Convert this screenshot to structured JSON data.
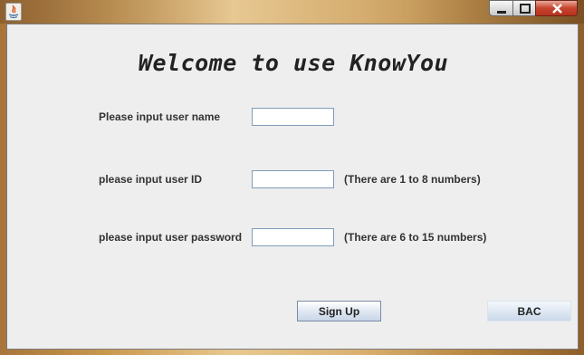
{
  "window": {
    "icon": "java-icon",
    "controls": [
      "minimize-icon",
      "maximize-icon",
      "close-icon"
    ]
  },
  "form": {
    "welcome": "Welcome to use KnowYou",
    "username": {
      "label": "Please input user name",
      "value": ""
    },
    "userid": {
      "label": "please input user ID",
      "value": "",
      "hint": "(There are 1 to 8 numbers)"
    },
    "password": {
      "label": "please input user password",
      "value": "",
      "hint": "(There are 6 to 15 numbers)"
    }
  },
  "buttons": {
    "signup": "Sign Up",
    "back": "BAC"
  },
  "colors": {
    "panel": "#eeeeee",
    "close_button": "#c6442e",
    "field_border": "#7f9db9"
  }
}
